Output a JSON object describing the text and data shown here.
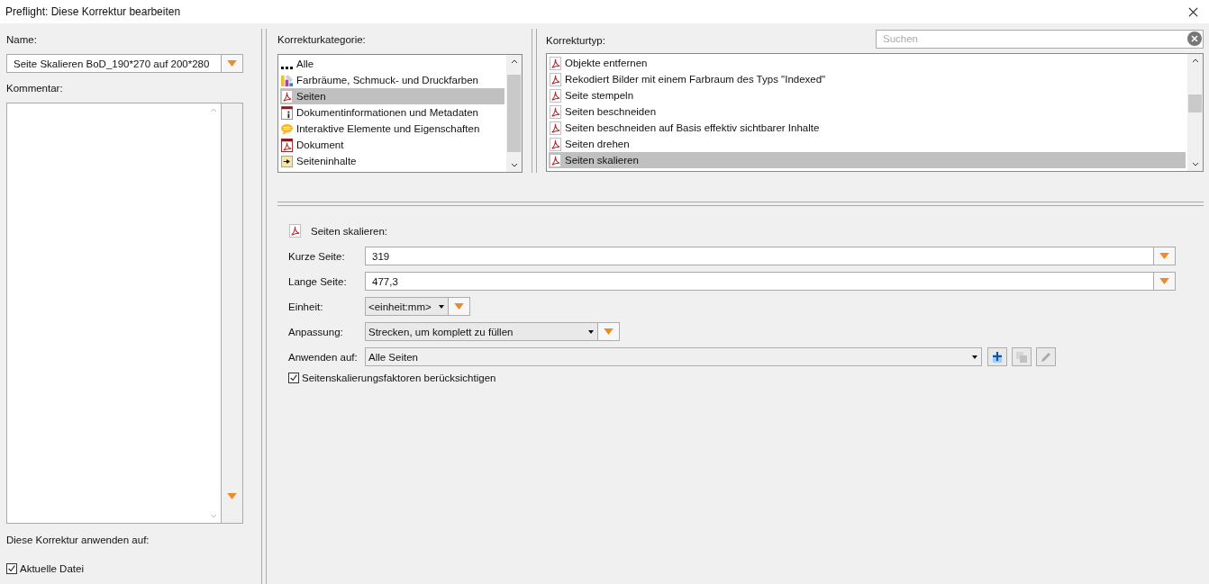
{
  "window": {
    "title": "Preflight: Diese Korrektur bearbeiten"
  },
  "left": {
    "name_label": "Name:",
    "name_value": "Seite Skalieren BoD_190*270 auf 200*280",
    "comment_label": "Kommentar:",
    "apply_label": "Diese Korrektur anwenden auf:",
    "apply_options": [
      {
        "label": "Aktuelle Datei",
        "checked": true
      }
    ]
  },
  "categories": {
    "label": "Korrekturkategorie:",
    "items": [
      {
        "label": "Alle",
        "kind": "dots",
        "selected": false
      },
      {
        "label": "Farbräume, Schmuck- und Druckfarben",
        "kind": "colors",
        "selected": false
      },
      {
        "label": "Seiten",
        "kind": "pdf",
        "selected": true
      },
      {
        "label": "Dokumentinformationen und Metadaten",
        "kind": "info",
        "selected": false
      },
      {
        "label": "Interaktive Elemente und Eigenschaften",
        "kind": "comment",
        "selected": false
      },
      {
        "label": "Dokument",
        "kind": "pdfdoc",
        "selected": false
      },
      {
        "label": "Seiteninhalte",
        "kind": "content",
        "selected": false
      }
    ]
  },
  "types": {
    "label": "Korrekturtyp:",
    "search": {
      "placeholder": "Suchen"
    },
    "items": [
      {
        "label": "Objekte entfernen",
        "selected": false
      },
      {
        "label": "Rekodiert Bilder mit einem Farbraum des Typs \"Indexed\"",
        "selected": false
      },
      {
        "label": "Seite stempeln",
        "selected": false
      },
      {
        "label": "Seiten beschneiden",
        "selected": false
      },
      {
        "label": "Seiten beschneiden auf Basis effektiv sichtbarer Inhalte",
        "selected": false
      },
      {
        "label": "Seiten drehen",
        "selected": false
      },
      {
        "label": "Seiten skalieren",
        "selected": true
      }
    ]
  },
  "form": {
    "heading": "Seiten skalieren:",
    "fields": [
      {
        "kind": "input",
        "label": "Kurze Seite:",
        "value": "319"
      },
      {
        "kind": "input",
        "label": "Lange Seite:",
        "value": "477,3"
      },
      {
        "kind": "combo",
        "label": "Einheit:",
        "value": "<einheit:mm>"
      },
      {
        "kind": "combo",
        "label": "Anpassung:",
        "value": "Strecken, um komplett zu füllen"
      },
      {
        "kind": "select",
        "label": "Anwenden auf:",
        "value": "Alle Seiten"
      }
    ],
    "option": {
      "label": "Seitenskalierungsfaktoren berücksichtigen",
      "checked": true
    }
  }
}
